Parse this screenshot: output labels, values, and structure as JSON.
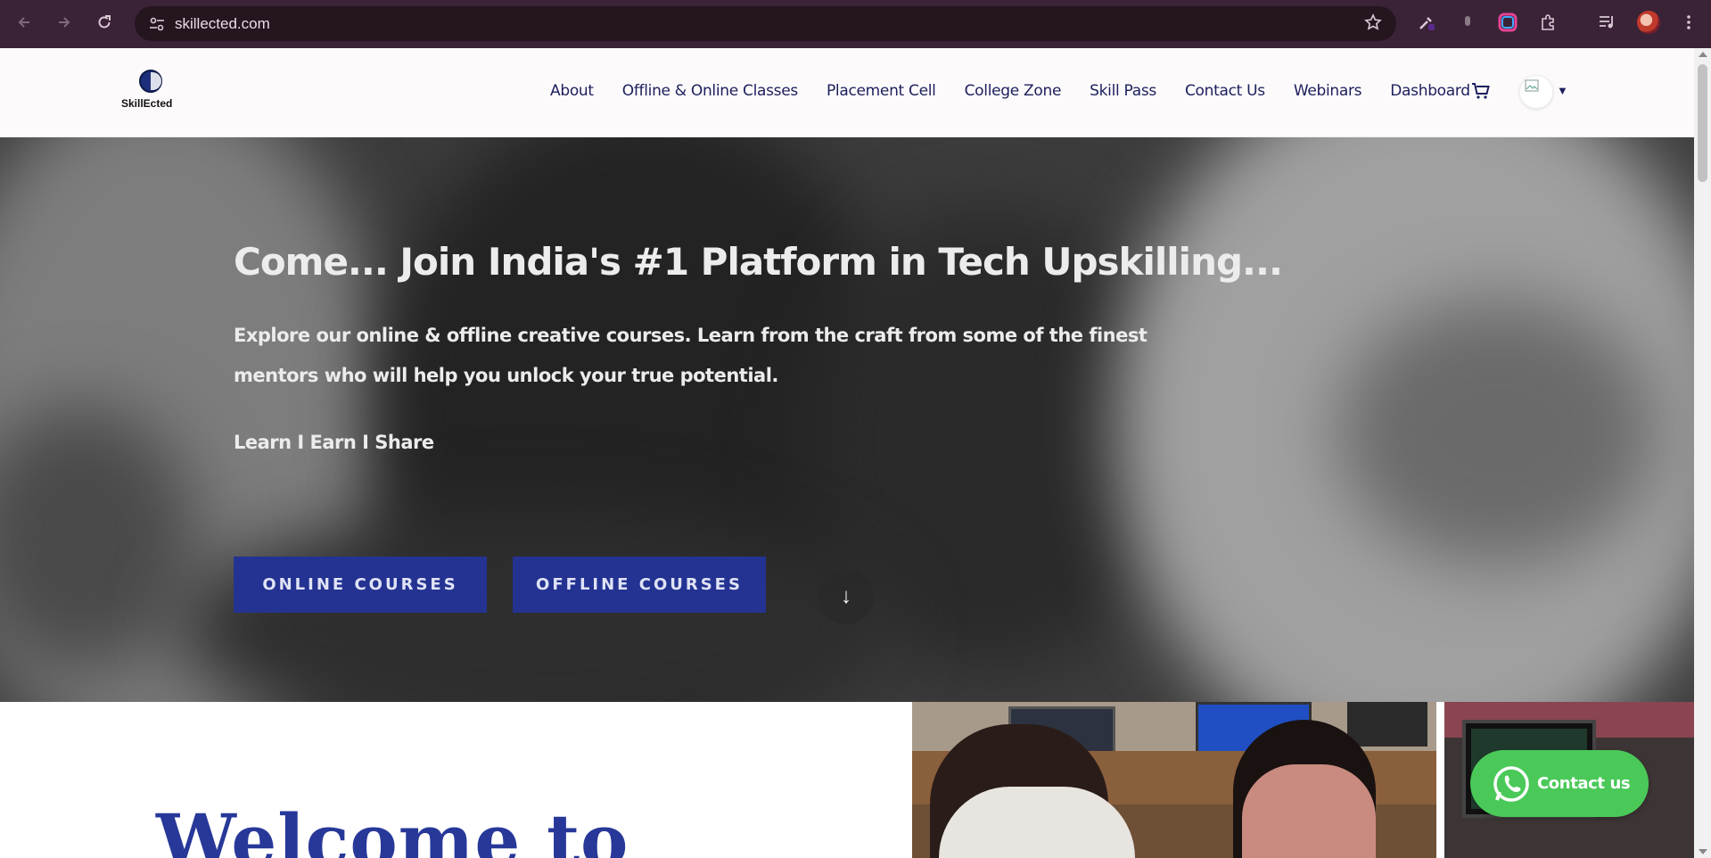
{
  "browser": {
    "url": "skillected.com",
    "back_icon": "arrow-left-icon",
    "forward_icon": "arrow-right-icon",
    "reload_icon": "reload-icon",
    "site_info_icon": "tune-icon",
    "bookmark_icon": "star-icon",
    "extensions": [
      "eyedropper-icon",
      "mic-icon",
      "color-ring-icon",
      "puzzle-icon",
      "media-icon"
    ],
    "menu_icon": "kebab-menu-icon",
    "chrome_color": "#3a2336"
  },
  "header": {
    "logo_text": "SkillEcted",
    "nav": [
      {
        "label": "About"
      },
      {
        "label": "Offline & Online Classes"
      },
      {
        "label": "Placement Cell"
      },
      {
        "label": "College Zone"
      },
      {
        "label": "Skill Pass"
      },
      {
        "label": "Contact Us"
      },
      {
        "label": "Webinars"
      },
      {
        "label": "Dashboard"
      }
    ],
    "nav_color": "#1b1f5c"
  },
  "hero": {
    "title": "Come... Join India's #1 Platform in Tech Upskilling...",
    "subtitle": "Explore our online & offline creative courses. Learn from the craft from some of the finest mentors who will help you unlock your true potential.",
    "tagline": "Learn I Earn I Share",
    "online_button": "ONLINE COURSES",
    "offline_button": "OFFLINE COURSES",
    "scroll_icon": "↓",
    "button_color": "#243391"
  },
  "welcome": {
    "heading": "Welcome to"
  },
  "whatsapp": {
    "label": "Contact us",
    "color": "#4ac959"
  }
}
